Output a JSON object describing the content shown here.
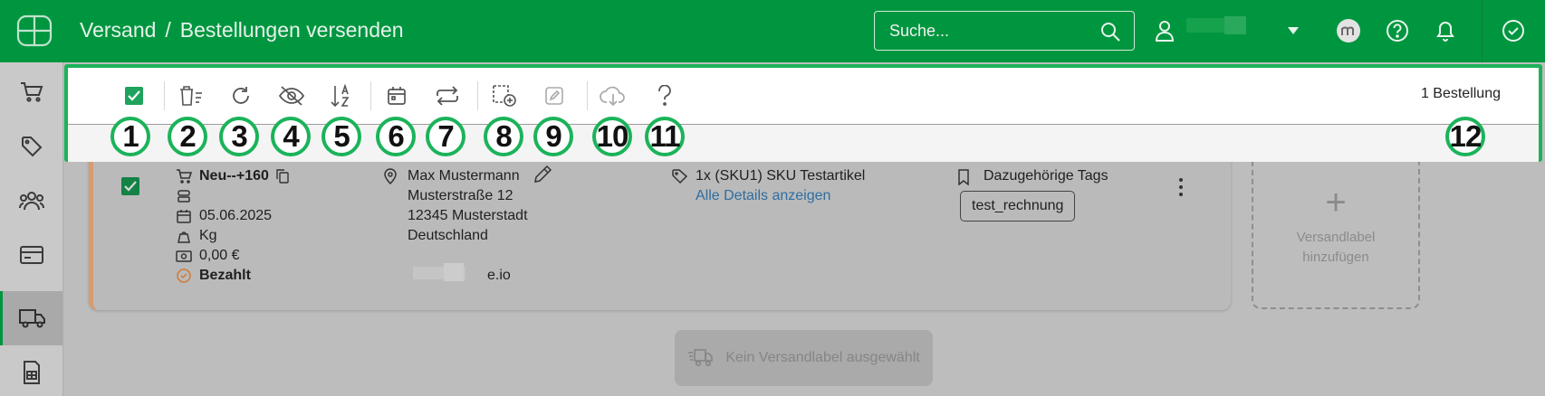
{
  "header": {
    "breadcrumb": [
      "Versand",
      "Bestellungen versenden"
    ],
    "breadcrumb_sep": "/",
    "search_placeholder": "Suche..."
  },
  "toolbar": {
    "order_count": "1 Bestellung",
    "badges": [
      "1",
      "2",
      "3",
      "4",
      "5",
      "6",
      "7",
      "8",
      "9",
      "10",
      "11",
      "12"
    ]
  },
  "order": {
    "number": "Neu--+160",
    "date": "05.06.2025",
    "weight_unit": "Kg",
    "amount": "0,00 €",
    "payment_status": "Bezahlt",
    "customer": {
      "name": "Max Mustermann",
      "street": "Musterstraße 12",
      "city": "12345 Musterstadt",
      "country": "Deutschland",
      "email_visible": "e.io"
    },
    "article": "1x (SKU1) SKU Testartikel",
    "details_link": "Alle Details anzeigen",
    "tags_heading": "Dazugehörige Tags",
    "tag": "test_rechnung"
  },
  "add_label": {
    "plus": "+",
    "line1": "Versandlabel",
    "line2": "hinzufügen"
  },
  "no_label_button": "Kein Versandlabel ausgewählt",
  "colors": {
    "brand": "#00963f",
    "highlight": "#1bb35a",
    "link": "#2f6da0",
    "card_accent": "#d79b6d"
  },
  "icons": {
    "sidebar": [
      "cart-icon",
      "tag-icon",
      "users-icon",
      "card-icon",
      "truck-icon",
      "receipt-icon"
    ],
    "toolbar": [
      "checkbox",
      "delete-list-icon",
      "refresh-icon",
      "eye-off-icon",
      "sort-az-icon",
      "calendar-icon",
      "transfer-icon",
      "select-add-icon",
      "edit-icon",
      "cloud-download-icon",
      "help-icon"
    ]
  }
}
